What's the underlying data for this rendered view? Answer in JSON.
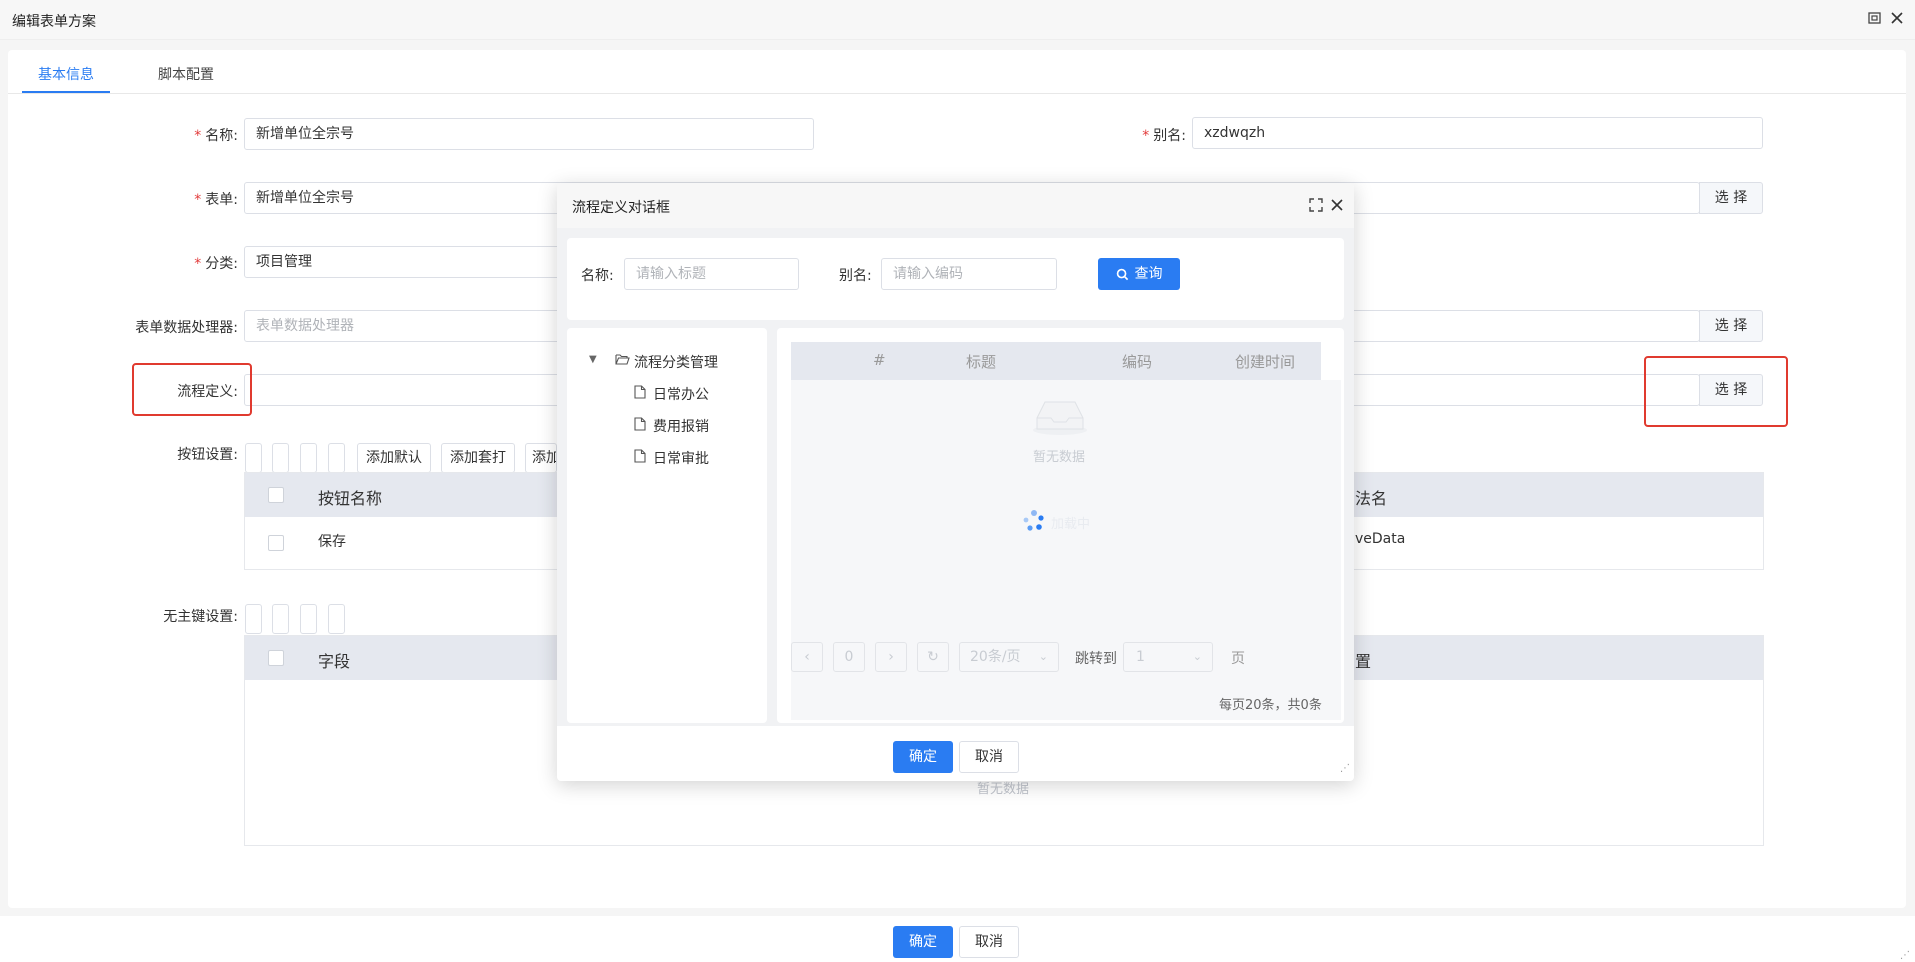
{
  "window": {
    "title": "编辑表单方案"
  },
  "tabs": [
    {
      "label": "基本信息"
    },
    {
      "label": "脚本配置"
    }
  ],
  "form": {
    "name_label": "名称:",
    "name_value": "新增单位全宗号",
    "alias_label": "别名:",
    "alias_value": "xzdwqzh",
    "form_label": "表单:",
    "form_value": "新增单位全宗号",
    "category_label": "分类:",
    "category_value": "项目管理",
    "processor_label": "表单数据处理器:",
    "processor_placeholder": "表单数据处理器",
    "process_label": "流程定义:",
    "select_label": "选 择",
    "button_settings_label": "按钮设置:",
    "no_pk_label": "无主键设置:",
    "required_mark": "*"
  },
  "button_toolbar": [
    "添加默认",
    "添加套打",
    "添加"
  ],
  "button_table": {
    "columns": [
      "按钮名称",
      "法名"
    ],
    "rows": [
      {
        "name": "保存",
        "method": "veData"
      }
    ]
  },
  "field_table": {
    "columns": [
      "字段",
      "置"
    ],
    "empty": "暂无数据"
  },
  "footer": {
    "confirm": "确定",
    "cancel": "取消"
  },
  "dialog": {
    "title": "流程定义对话框",
    "search": {
      "name_label": "名称:",
      "name_placeholder": "请输入标题",
      "alias_label": "别名:",
      "alias_placeholder": "请输入编码",
      "query_label": "查询"
    },
    "tree": {
      "root": "流程分类管理",
      "children": [
        "日常办公",
        "费用报销",
        "日常审批"
      ]
    },
    "table": {
      "columns": [
        "#",
        "标题",
        "编码",
        "创建时间"
      ],
      "empty": "暂无数据",
      "loading": "加载中"
    },
    "pager": {
      "page": "0",
      "page_size": "20条/页",
      "jump_label": "跳转到",
      "jump_value": "1",
      "page_unit": "页",
      "summary": "每页20条，共0条"
    },
    "confirm": "确定",
    "cancel": "取消"
  },
  "colors": {
    "primary": "#2a7cf2",
    "required": "#e23a3a",
    "highlight": "#e03a2f"
  }
}
